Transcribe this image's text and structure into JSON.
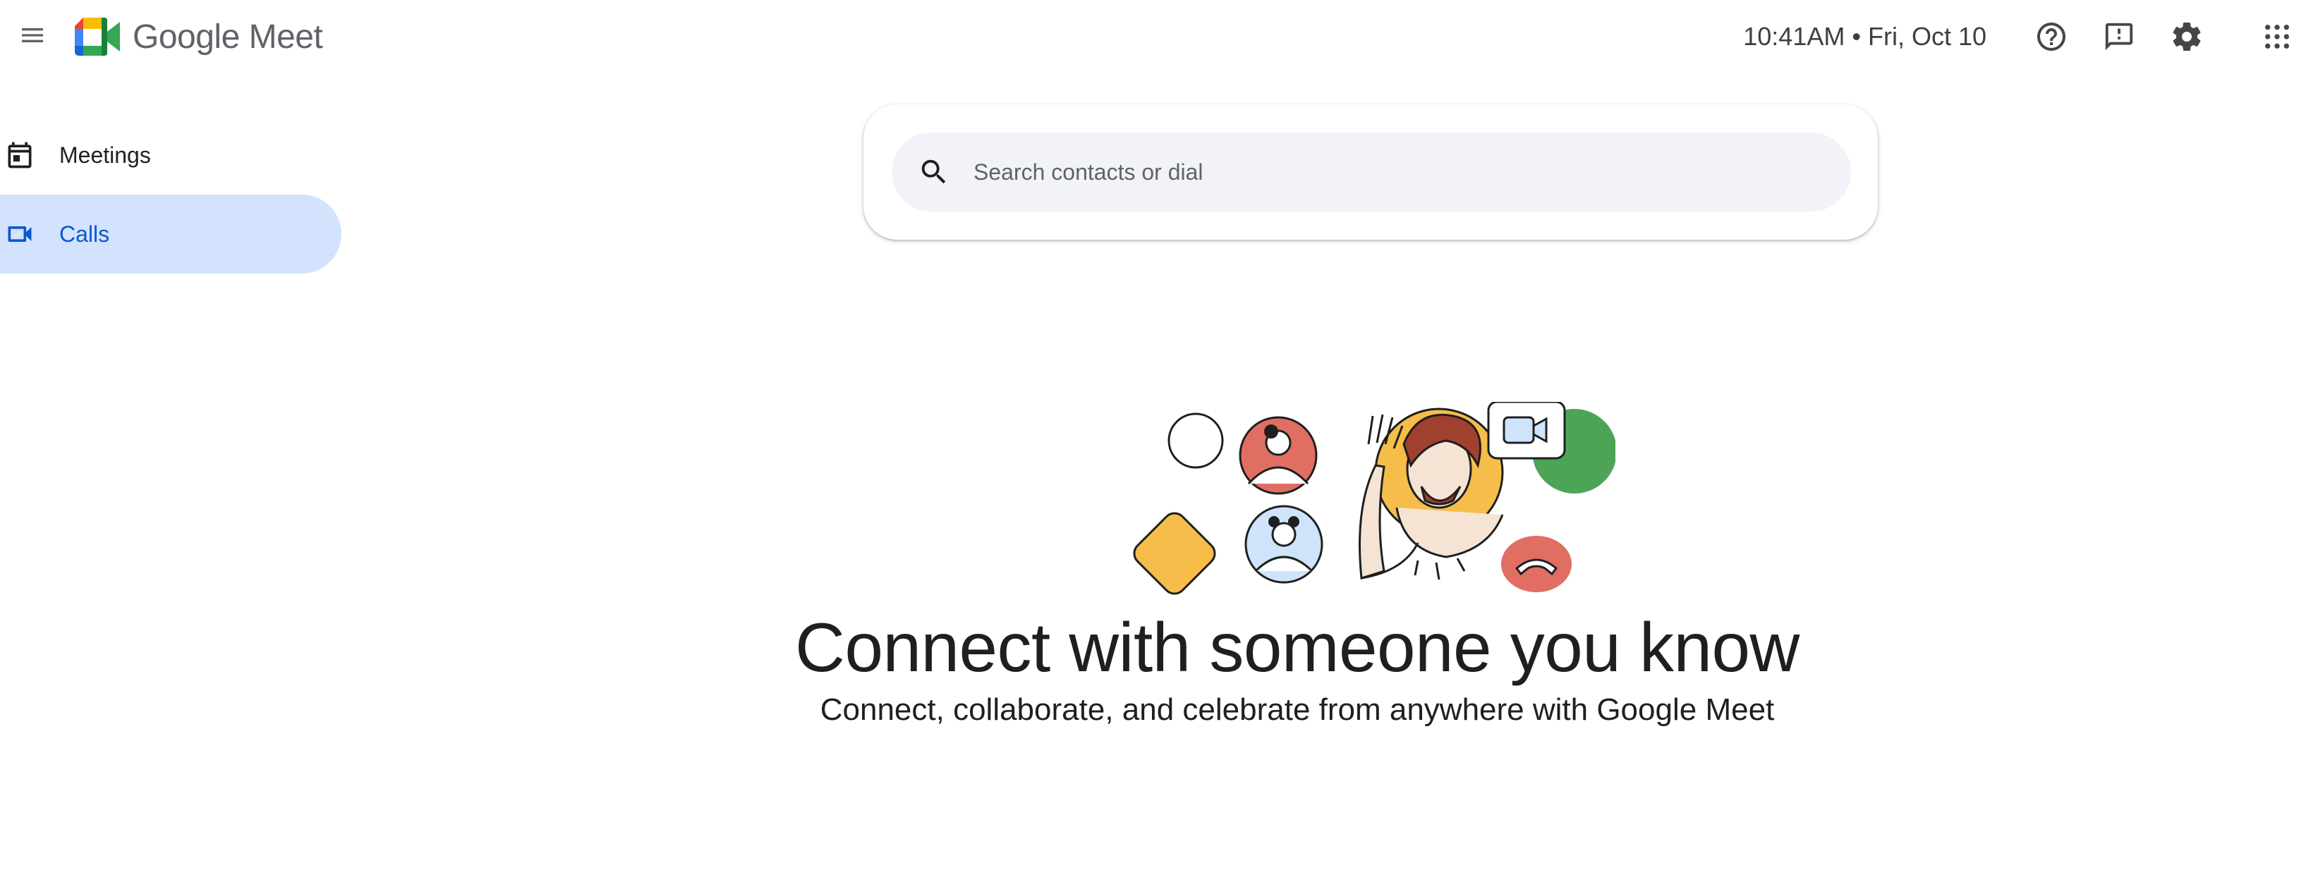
{
  "header": {
    "menu_icon": "hamburger-menu-icon",
    "logo_icon": "google-meet-logo-icon",
    "logo_google": "Google",
    "logo_product": "Meet",
    "clock": "10:41AM • Fri, Oct 10",
    "help_icon": "help-icon",
    "feedback_icon": "feedback-icon",
    "settings_icon": "gear-icon",
    "apps_icon": "apps-grid-icon"
  },
  "sidebar": {
    "items": [
      {
        "label": "Meetings",
        "icon": "calendar-icon",
        "active": false
      },
      {
        "label": "Calls",
        "icon": "video-camera-icon",
        "active": true
      }
    ]
  },
  "search": {
    "placeholder": "Search contacts or dial",
    "value": "",
    "icon": "search-icon"
  },
  "hero": {
    "title": "Connect with someone you know",
    "subtitle": "Connect, collaborate, and celebrate from anywhere with Google Meet"
  },
  "colors": {
    "active_nav_bg": "#d3e3fd",
    "active_nav_text": "#0b57d0",
    "search_bg": "#f1f3f8",
    "meet_green": "#34a853",
    "meet_blue": "#4285f4",
    "meet_yellow": "#fbbc04",
    "meet_red": "#ea4335"
  }
}
